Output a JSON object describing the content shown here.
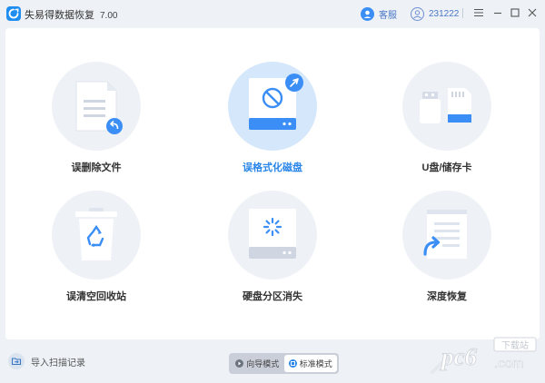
{
  "window": {
    "title": "失易得数据恢复",
    "version": "7.00",
    "service_label": "客服",
    "user_id": "231222",
    "icons": [
      "app-logo-icon",
      "headset-icon",
      "user-icon",
      "menu-icon",
      "minimize-icon",
      "maximize-icon",
      "close-icon"
    ]
  },
  "cards": [
    {
      "label": "误删除文件",
      "icon": "deleted-file-icon",
      "active": false
    },
    {
      "label": "误格式化磁盘",
      "icon": "formatted-disk-icon",
      "active": true
    },
    {
      "label": "U盘/储存卡",
      "icon": "usb-card-icon",
      "active": false
    },
    {
      "label": "误清空回收站",
      "icon": "recycle-bin-icon",
      "active": false
    },
    {
      "label": "硬盘分区消失",
      "icon": "partition-lost-icon",
      "active": false
    },
    {
      "label": "深度恢复",
      "icon": "deep-recovery-icon",
      "active": false
    }
  ],
  "footer": {
    "import_label": "导入扫描记录",
    "modes": [
      {
        "label": "向导模式",
        "selected": false
      },
      {
        "label": "标准模式",
        "selected": true
      }
    ]
  },
  "watermark": {
    "brand": "pc6",
    "site": ".com",
    "tag": "下载站"
  },
  "colors": {
    "accent": "#2a86e8",
    "active_bg": "#d5e7fb",
    "circle_bg": "#eef1f6",
    "window_bg": "#eef1f6"
  }
}
